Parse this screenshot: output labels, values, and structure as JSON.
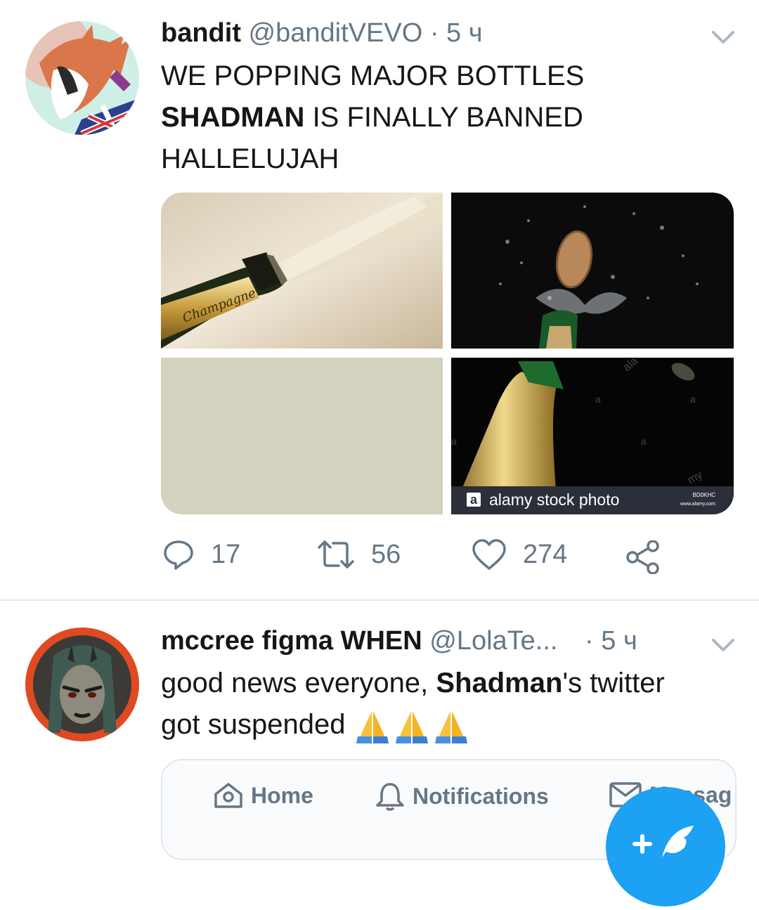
{
  "tweets": [
    {
      "name": "bandit",
      "handle": "@banditVEVO",
      "separator": "·",
      "time": "5 ч",
      "text_lines": [
        "WE POPPING MAJOR BOTTLES",
        "IS FINALLY BANNED",
        "HALLELUJAH"
      ],
      "text_bold": "SHADMAN",
      "media_watermark": "alamy stock photo",
      "media_watermark_code": "BD0KHC",
      "media_watermark_url": "www.alamy.com",
      "media_label": "Champagne",
      "stats": {
        "replies": "17",
        "retweets": "56",
        "likes": "274"
      }
    },
    {
      "name": "mccree figma WHEN",
      "handle": "@LolaTe...",
      "separator": "·",
      "time": "5 ч",
      "text_pre": "good news everyone,",
      "text_bold": "Shadman",
      "text_post": "'s twitter",
      "text_line2": "got suspended",
      "card_nav": {
        "home": "Home",
        "notifications": "Notifications",
        "messages": "Messag"
      }
    }
  ],
  "colors": {
    "accent": "#1da1f2",
    "muted": "#657786",
    "text": "#14171a",
    "divider": "#e1e8ed"
  },
  "icons": [
    "chevron-down-icon",
    "reply-icon",
    "retweet-icon",
    "like-icon",
    "share-icon",
    "home-icon",
    "bell-icon",
    "envelope-icon",
    "compose-icon",
    "folded-hands-emoji"
  ]
}
